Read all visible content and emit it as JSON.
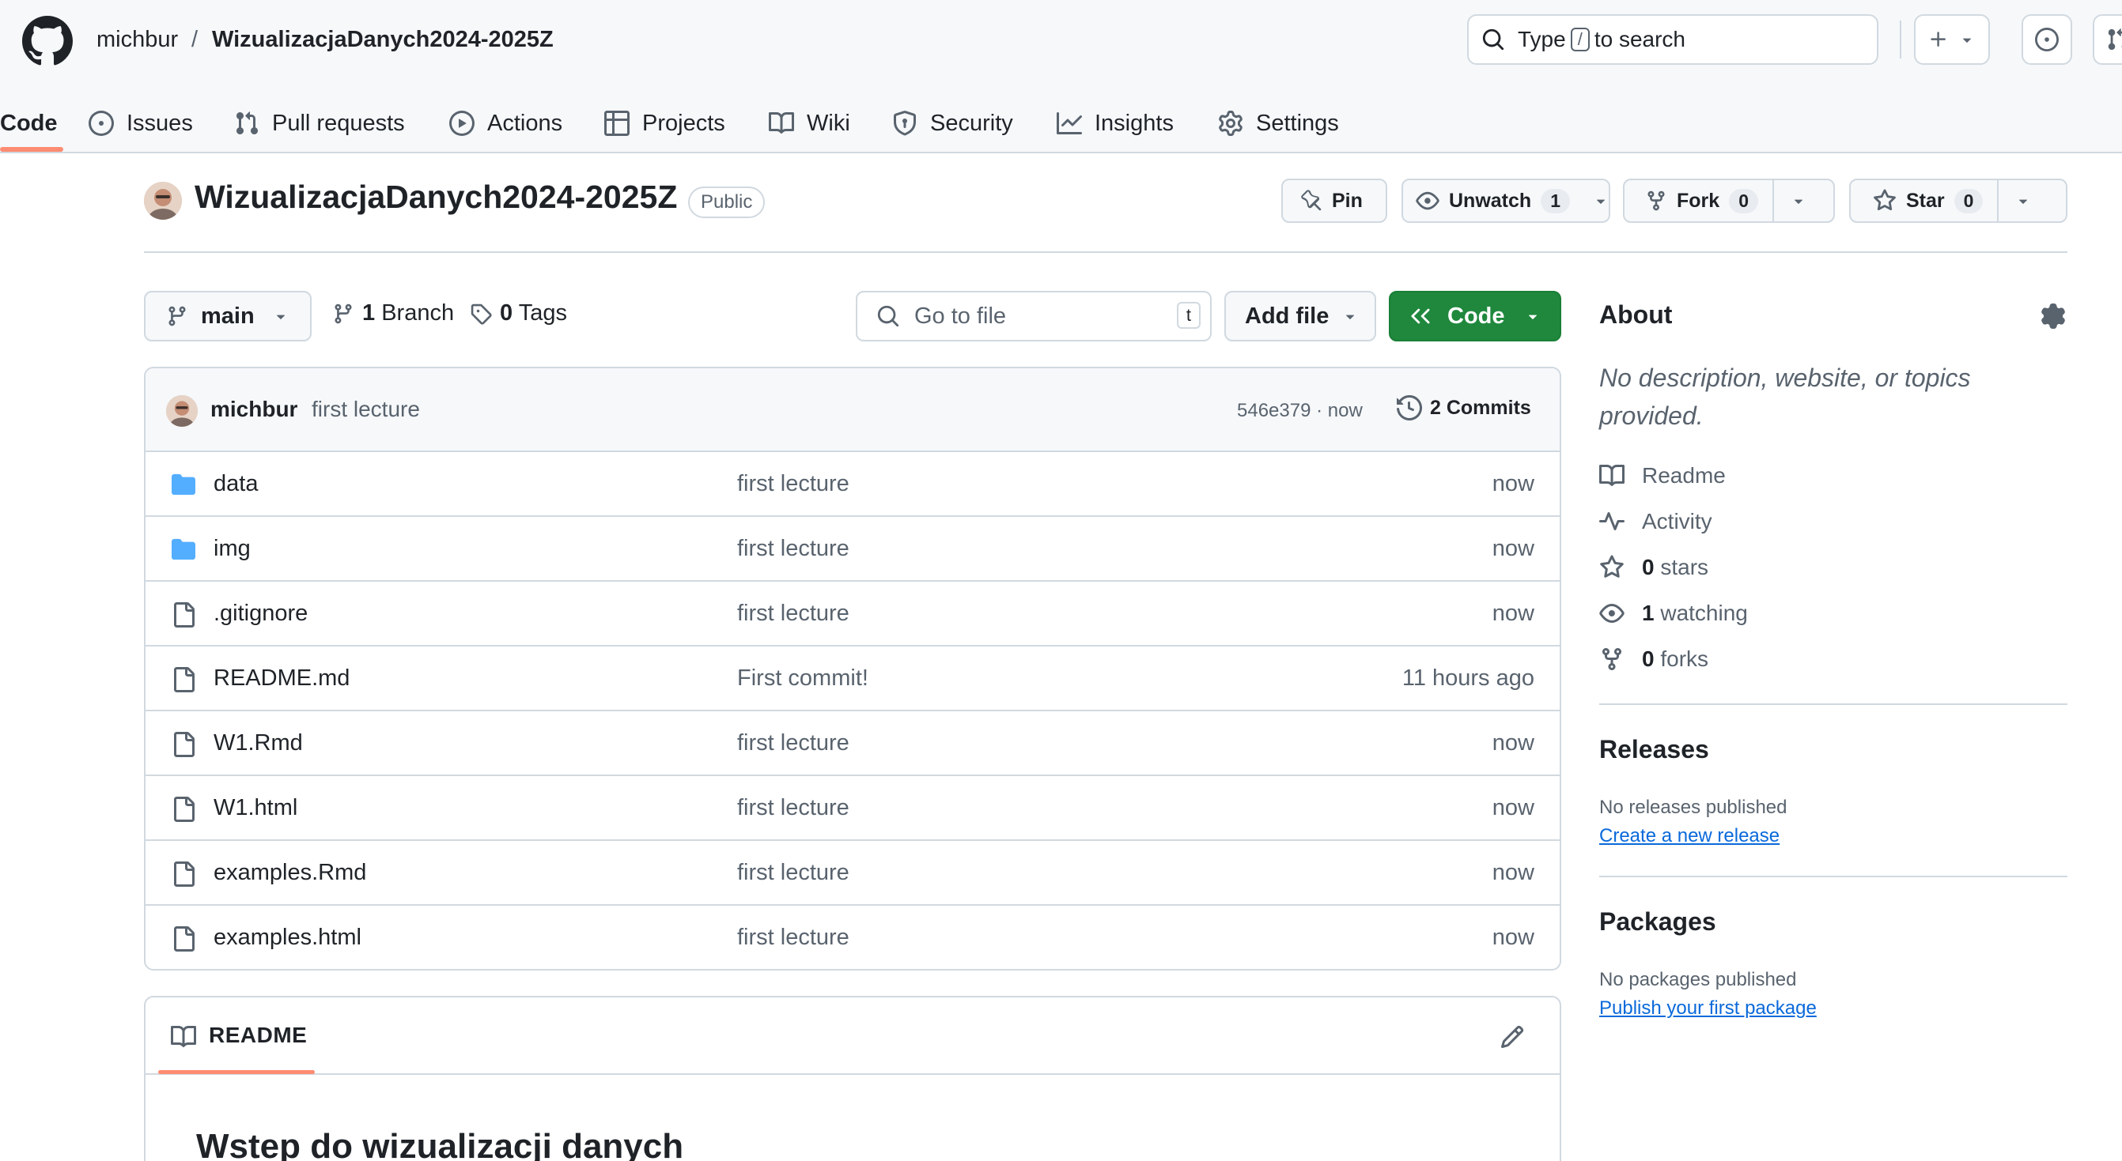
{
  "header": {
    "owner": "michbur",
    "separator": "/",
    "repo": "WizualizacjaDanych2024-2025Z",
    "search_prefix": "Type",
    "search_key": "/",
    "search_suffix": "to search"
  },
  "tabs": [
    {
      "label": "Code",
      "icon": "code-icon"
    },
    {
      "label": "Issues",
      "icon": "issue-icon"
    },
    {
      "label": "Pull requests",
      "icon": "pull-request-icon"
    },
    {
      "label": "Actions",
      "icon": "play-icon"
    },
    {
      "label": "Projects",
      "icon": "table-icon"
    },
    {
      "label": "Wiki",
      "icon": "book-icon"
    },
    {
      "label": "Security",
      "icon": "shield-icon"
    },
    {
      "label": "Insights",
      "icon": "graph-icon"
    },
    {
      "label": "Settings",
      "icon": "gear-icon"
    }
  ],
  "repo_title": {
    "name": "WizualizacjaDanych2024-2025Z",
    "visibility": "Public",
    "pin": "Pin",
    "unwatch": "Unwatch",
    "watch_count": "1",
    "fork": "Fork",
    "fork_count": "0",
    "star": "Star",
    "star_count": "0"
  },
  "controls": {
    "branch": "main",
    "branch_count": "1",
    "branch_label": "Branch",
    "tag_count": "0",
    "tag_label": "Tags",
    "goto_placeholder": "Go to file",
    "goto_key": "t",
    "add_file": "Add file",
    "code": "Code"
  },
  "commit": {
    "author": "michbur",
    "message": "first lecture",
    "hash_time": "546e379 · now",
    "commits": "2 Commits"
  },
  "files": [
    {
      "name": "data",
      "type": "folder",
      "message": "first lecture",
      "time": "now"
    },
    {
      "name": "img",
      "type": "folder",
      "message": "first lecture",
      "time": "now"
    },
    {
      "name": ".gitignore",
      "type": "file",
      "message": "first lecture",
      "time": "now"
    },
    {
      "name": "README.md",
      "type": "file",
      "message": "First commit!",
      "time": "11 hours ago"
    },
    {
      "name": "W1.Rmd",
      "type": "file",
      "message": "first lecture",
      "time": "now"
    },
    {
      "name": "W1.html",
      "type": "file",
      "message": "first lecture",
      "time": "now"
    },
    {
      "name": "examples.Rmd",
      "type": "file",
      "message": "first lecture",
      "time": "now"
    },
    {
      "name": "examples.html",
      "type": "file",
      "message": "first lecture",
      "time": "now"
    }
  ],
  "readme": {
    "label": "README",
    "heading": "Wstep do wizualizacji danych"
  },
  "about": {
    "title": "About",
    "description": "No description, website, or topics provided.",
    "readme": "Readme",
    "activity": "Activity",
    "stars_count": "0",
    "stars_label": "stars",
    "watching_count": "1",
    "watching_label": "watching",
    "forks_count": "0",
    "forks_label": "forks"
  },
  "releases": {
    "title": "Releases",
    "empty": "No releases published",
    "link": "Create a new release"
  },
  "packages": {
    "title": "Packages",
    "empty": "No packages published",
    "link": "Publish your first package"
  },
  "colors": {
    "accent_green": "#1f883d",
    "tab_underline": "#fd8c73",
    "link_blue": "#0969da",
    "folder_blue": "#54aeff"
  }
}
